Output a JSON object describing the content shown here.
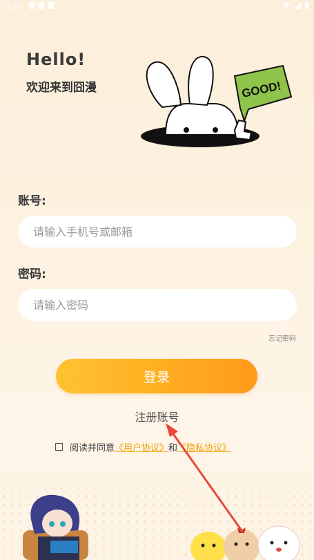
{
  "status_bar": {
    "time": "2:05"
  },
  "header": {
    "hello": "Hello!",
    "welcome": "欢迎来到囧漫",
    "mascot_bubble": "GOOD!"
  },
  "form": {
    "account_label": "账号:",
    "account_placeholder": "请输入手机号或邮箱",
    "password_label": "密码:",
    "password_placeholder": "请输入密码",
    "forgot_password": "忘记密码",
    "login_button": "登录",
    "register_link": "注册账号"
  },
  "agreement": {
    "prefix": "阅读并同意",
    "user_agreement": "《用户协议》",
    "and": "和",
    "privacy_policy": "《隐私协议》"
  },
  "colors": {
    "accent": "#ffad21",
    "link": "#f2a20c",
    "arrow": "#e8483a"
  }
}
